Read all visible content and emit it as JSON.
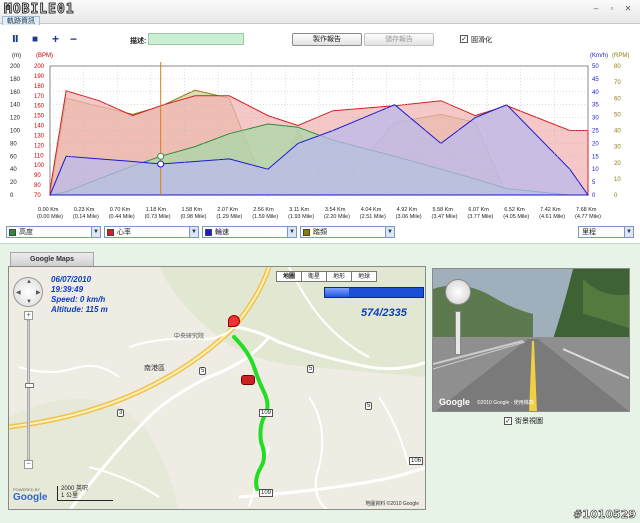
{
  "app": {
    "logo_text": "MOBILE01",
    "track_tab": "軌跡資訊"
  },
  "window_controls": [
    "–",
    "▫",
    "✕"
  ],
  "toolbar": {
    "pause_icon": "Ⅱ",
    "stop_icon": "■",
    "zoom_in_icon": "+",
    "zoom_out_icon": "−",
    "desc_label": "描述:",
    "desc_value": "",
    "make_report": "製作報告",
    "save_report": "儲存報告",
    "smooth_label": "圓滑化",
    "smooth_checked": "✓"
  },
  "chart_data": {
    "type": "area",
    "left_axis_unit_m": "(m)",
    "left_axis_unit_bpm": "(BPM)",
    "right_axis_unit_kmh": "(Km/h)",
    "right_axis_unit_rpm": "(RPM)",
    "left_m_ticks": [
      "200",
      "180",
      "160",
      "140",
      "120",
      "100",
      "80",
      "60",
      "40",
      "20",
      "0"
    ],
    "left_bpm_ticks": [
      "200",
      "190",
      "180",
      "170",
      "160",
      "150",
      "140",
      "130",
      "120",
      "110",
      "100",
      "90",
      "80",
      "70"
    ],
    "right_kmh_ticks": [
      "50",
      "45",
      "40",
      "35",
      "30",
      "25",
      "20",
      "15",
      "10",
      "5",
      "0"
    ],
    "right_rpm_ticks": [
      "80",
      "70",
      "60",
      "50",
      "40",
      "30",
      "20",
      "10",
      "0"
    ],
    "x_km": [
      "0.00 Km",
      "0.23 Km",
      "0.70 Km",
      "1.18 Km",
      "1.58 Km",
      "2.07 Km",
      "2.56 Km",
      "3.11 Km",
      "3.54 Km",
      "4.04 Km",
      "4.92 Km",
      "5.58 Km",
      "6.07 Km",
      "6.52 Km",
      "7.42 Km",
      "7.68 Km"
    ],
    "x_mile": [
      "(0.00 Mile)",
      "(0.14 Mile)",
      "(0.44 Mile)",
      "(0.73 Mile)",
      "(0.98 Mile)",
      "(1.29 Mile)",
      "(1.59 Mile)",
      "(1.93 Mile)",
      "(2.20 Mile)",
      "(2.51 Mile)",
      "(3.06 Mile)",
      "(3.47 Mile)",
      "(3.77 Mile)",
      "(4.05 Mile)",
      "(4.61 Mile)",
      "(4.77 Mile)"
    ],
    "cursor_km": 1.58,
    "series": [
      {
        "name": "高度",
        "color": "#2e8b3a",
        "fill": "#a8d8a8",
        "x": [
          0,
          0.23,
          0.7,
          1.18,
          1.58,
          2.07,
          2.56,
          3.11,
          3.54,
          4.04,
          4.92,
          5.58,
          6.07,
          6.52,
          7.42,
          7.68
        ],
        "values": [
          0,
          5,
          25,
          45,
          60,
          75,
          95,
          110,
          105,
          85,
          60,
          40,
          25,
          10,
          0,
          0
        ]
      },
      {
        "name": "心率",
        "color": "#d42020",
        "fill": "#f1b4b4",
        "x": [
          0,
          0.23,
          0.7,
          1.18,
          1.58,
          2.07,
          2.56,
          3.11,
          3.54,
          4.04,
          4.92,
          5.58,
          6.07,
          6.52,
          7.42,
          7.68
        ],
        "values": [
          75,
          175,
          165,
          150,
          160,
          170,
          170,
          150,
          140,
          155,
          160,
          165,
          150,
          160,
          135,
          135
        ]
      },
      {
        "name": "輪速",
        "color": "#1a1ad0",
        "fill": "#b9b9ee",
        "x": [
          0,
          0.23,
          0.7,
          1.18,
          1.58,
          2.07,
          2.56,
          3.11,
          3.54,
          4.04,
          4.92,
          5.58,
          6.07,
          6.52,
          7.42,
          7.68
        ],
        "values": [
          0,
          15,
          14,
          13,
          12,
          13,
          14,
          10,
          20,
          25,
          35,
          20,
          30,
          35,
          10,
          0
        ]
      },
      {
        "name": "踏頻",
        "color": "#8a7a10",
        "fill": "#d8cf9a",
        "x": [
          0,
          0.23,
          0.7,
          1.18,
          1.58,
          2.07,
          2.56,
          3.11,
          3.54,
          4.04,
          4.92,
          5.58,
          6.07,
          6.52,
          7.42,
          7.68
        ],
        "values": [
          0,
          60,
          55,
          50,
          55,
          65,
          60,
          0,
          40,
          0,
          45,
          50,
          45,
          0,
          0,
          0
        ]
      }
    ],
    "grid": true,
    "legend": "bottom"
  },
  "legend_dropdowns": [
    {
      "label": "高度",
      "color": "#2e8b3a"
    },
    {
      "label": "心率",
      "color": "#d42020"
    },
    {
      "label": "輪速",
      "color": "#1a1ad0"
    },
    {
      "label": "踏頻",
      "color": "#8a7a10"
    }
  ],
  "xaxis_select": "里程",
  "map": {
    "tab": "Google Maps",
    "date": "06/07/2010",
    "time": "19:39:49",
    "speed": "Speed: 0 km/h",
    "altitude": "Altitude: 115 m",
    "types": [
      "地圖",
      "衛星",
      "地形",
      "地球"
    ],
    "active_type": "地圖",
    "counter": "574/2335",
    "progress": 0.246,
    "scale_top": "2000 英呎",
    "scale_bottom": "1 公里",
    "google": "Google",
    "powered": "POWERED BY",
    "copyright": "地圖資料 ©2010 Google",
    "place_labels": [
      "中央研究院",
      "南港區",
      "109",
      "5",
      "3",
      "5",
      "5",
      "109",
      "106"
    ]
  },
  "street_view": {
    "google": "Google",
    "copyright": "©2010 Google · 使用條款",
    "caption": "街景視圖",
    "checked": "✓"
  },
  "watermark": "#1010529"
}
